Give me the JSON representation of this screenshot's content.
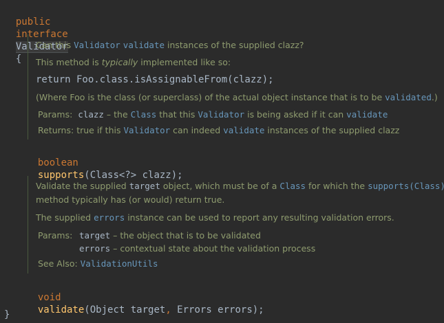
{
  "header": {
    "public_kw": "public",
    "interface_kw": "interface",
    "name": "Validator",
    "open_brace": "{"
  },
  "doc1": {
    "l1_a": "Can this ",
    "l1_link1": "Validator",
    "l1_b": " ",
    "l1_link2": "validate",
    "l1_c": " instances of the supplied clazz?",
    "l2_a": "This method is ",
    "l2_em": "typically",
    "l2_b": " implemented like so:",
    "l3_code": "return Foo.class.isAssignableFrom(clazz);",
    "l4_a": "(Where Foo is the class (or superclass) of the actual object instance that is to be ",
    "l4_link": "validated",
    "l4_b": ".)",
    "params_label": "Params:",
    "param_name": "clazz",
    "param_a": " – the ",
    "param_link1": "Class",
    "param_b": " that this ",
    "param_link2": "Validator",
    "param_c": " is being asked if it can ",
    "param_link3": "validate",
    "returns_label": "Returns:",
    "ret_a": " true if this ",
    "ret_link1": "Validator",
    "ret_b": " can indeed ",
    "ret_link2": "validate",
    "ret_c": " instances of the supplied clazz"
  },
  "method1": {
    "type_kw": "boolean",
    "name": "supports",
    "params": "(Class<?> clazz);"
  },
  "doc2": {
    "l1_a": "Validate the supplied ",
    "l1_code": "target",
    "l1_b": " object, which must be of a ",
    "l1_link1": "Class",
    "l1_c": " for which the ",
    "l1_link2": "supports(Class)",
    "l2": "method typically has (or would) return true.",
    "l3_a": "The supplied ",
    "l3_link": "errors",
    "l3_b": " instance can be used to report any resulting validation errors.",
    "params_label": "Params:",
    "p1_name": "target",
    "p1_desc": " – the object that is to be validated",
    "p2_name": "errors",
    "p2_desc": " – contextual state about the validation process",
    "see_label": "See Also:",
    "see_link": "ValidationUtils"
  },
  "method2": {
    "type_kw": "void",
    "name": "validate",
    "open": "(Object target",
    "comma": ",",
    "rest": " Errors errors);"
  },
  "footer": {
    "close_brace": "}"
  }
}
